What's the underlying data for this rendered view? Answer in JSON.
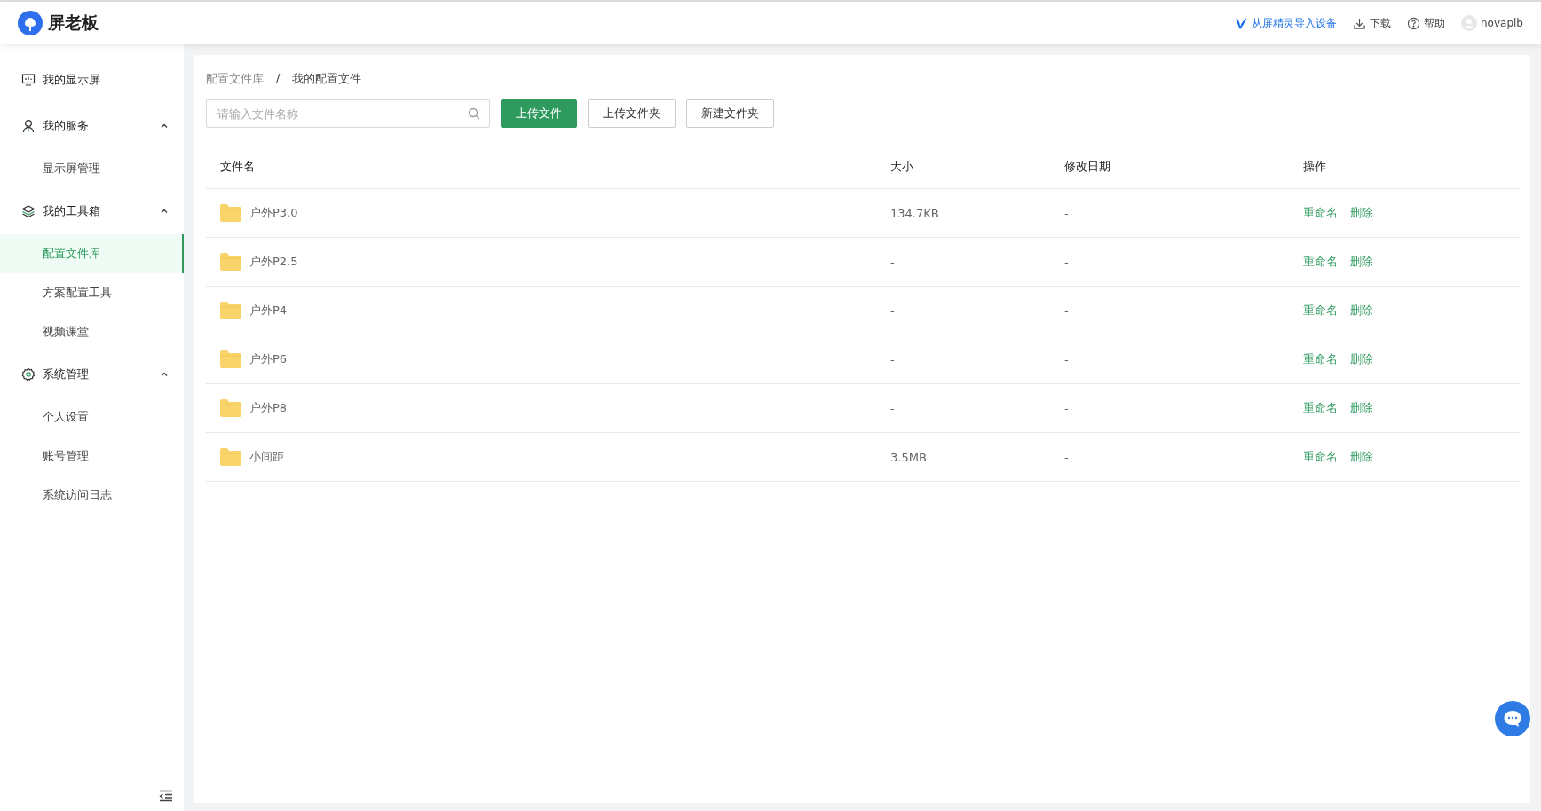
{
  "header": {
    "logo_text": "屏老板",
    "links": [
      {
        "kind": "import",
        "label": "从屏精灵导入设备"
      },
      {
        "kind": "download",
        "label": "下载"
      },
      {
        "kind": "help",
        "label": "帮助"
      },
      {
        "kind": "user",
        "label": "novaplb"
      }
    ]
  },
  "sidebar": {
    "items": [
      {
        "kind": "monitor",
        "label": "我的显示屏",
        "selected": false
      },
      {
        "kind": "person",
        "label": "我的服务",
        "expanded": true,
        "children": [
          {
            "label": "显示屏管理",
            "selected": false
          }
        ]
      },
      {
        "kind": "layers",
        "label": "我的工具箱",
        "expanded": true,
        "children": [
          {
            "label": "配置文件库",
            "selected": true
          },
          {
            "label": "方案配置工具",
            "selected": false
          },
          {
            "label": "视频课堂",
            "selected": false
          }
        ]
      },
      {
        "kind": "gear",
        "label": "系统管理",
        "expanded": true,
        "children": [
          {
            "label": "个人设置",
            "selected": false
          },
          {
            "label": "账号管理",
            "selected": false
          },
          {
            "label": "系统访问日志",
            "selected": false
          }
        ]
      }
    ]
  },
  "breadcrumb": [
    "配置文件库",
    "/",
    "我的配置文件"
  ],
  "search": {
    "placeholder": "请输入文件名称"
  },
  "buttons": [
    {
      "label": "上传文件",
      "primary": true
    },
    {
      "label": "上传文件夹",
      "primary": false
    },
    {
      "label": "新建文件夹",
      "primary": false
    }
  ],
  "table": {
    "columns": [
      "文件名",
      "大小",
      "修改日期",
      "操作"
    ],
    "rows": [
      {
        "name": "户外P3.0",
        "size": "134.7KB",
        "date": "-",
        "actions": [
          "重命名",
          "删除"
        ]
      },
      {
        "name": "户外P2.5",
        "size": "-",
        "date": "-",
        "actions": [
          "重命名",
          "删除"
        ]
      },
      {
        "name": "户外P4",
        "size": "-",
        "date": "-",
        "actions": [
          "重命名",
          "删除"
        ]
      },
      {
        "name": "户外P6",
        "size": "-",
        "date": "-",
        "actions": [
          "重命名",
          "删除"
        ]
      },
      {
        "name": "户外P8",
        "size": "-",
        "date": "-",
        "actions": [
          "重命名",
          "删除"
        ]
      },
      {
        "name": "小间距",
        "size": "3.5MB",
        "date": "-",
        "actions": [
          "重命名",
          "删除"
        ]
      }
    ]
  }
}
